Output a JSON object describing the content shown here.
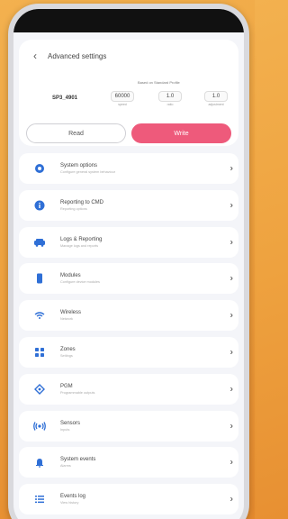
{
  "header": {
    "back_icon": "chevron-left-icon",
    "title": "Advanced settings"
  },
  "stats": {
    "caption": "Based on Standard Profile",
    "main_value": "SP3_4901",
    "items": [
      {
        "value": "60000",
        "label": "speed"
      },
      {
        "value": "1.0",
        "label": "ratio"
      },
      {
        "value": "1.0",
        "label": "adjustment"
      }
    ]
  },
  "mode_toggle": {
    "read_label": "Read",
    "write_label": "Write",
    "active": "write",
    "active_color": "#ee5a7b"
  },
  "settings": [
    {
      "title": "System options",
      "subtitle": "Configure general system behaviour",
      "icon": "gear-icon"
    },
    {
      "title": "Reporting to CMD",
      "subtitle": "Reporting options",
      "icon": "info-icon"
    },
    {
      "title": "Logs & Reporting",
      "subtitle": "Manage logs and reports",
      "icon": "car-icon"
    },
    {
      "title": "Modules",
      "subtitle": "Configure device modules",
      "icon": "device-icon"
    },
    {
      "title": "Wireless",
      "subtitle": "Network",
      "icon": "wifi-icon"
    },
    {
      "title": "Zones",
      "subtitle": "Settings",
      "icon": "grid-icon"
    },
    {
      "title": "PGM",
      "subtitle": "Programmable outputs",
      "icon": "diamond-icon"
    },
    {
      "title": "Sensors",
      "subtitle": "Inputs",
      "icon": "broadcast-icon"
    },
    {
      "title": "System events",
      "subtitle": "Alarms",
      "icon": "bell-icon"
    },
    {
      "title": "Events log",
      "subtitle": "View history",
      "icon": "list-icon"
    }
  ],
  "colors": {
    "accent": "#ee5a7b",
    "icon_blue": "#2f6fd6",
    "background": "#f0a443"
  }
}
